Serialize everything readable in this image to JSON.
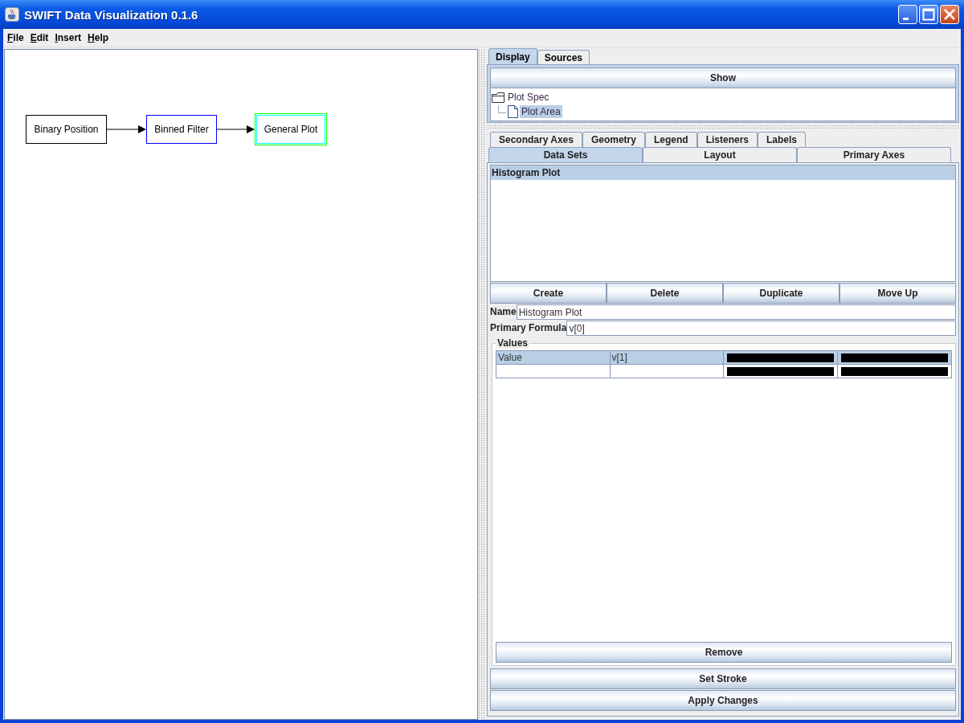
{
  "window": {
    "title": "SWIFT Data Visualization 0.1.6"
  },
  "menu": [
    {
      "label": "File"
    },
    {
      "label": "Edit"
    },
    {
      "label": "Insert"
    },
    {
      "label": "Help"
    }
  ],
  "canvas": {
    "nodes": [
      {
        "label": "Binary Position",
        "color": "#000000",
        "selected": false
      },
      {
        "label": "Binned Filter",
        "color": "#0000ff",
        "selected": false
      },
      {
        "label": "General Plot",
        "color": "#00ff00",
        "selected": true
      }
    ]
  },
  "tabs": [
    {
      "label": "Display",
      "selected": true
    },
    {
      "label": "Sources",
      "selected": false
    }
  ],
  "show_button": "Show",
  "tree": [
    {
      "label": "Plot Spec",
      "kind": "folder",
      "selected": false,
      "children": [
        {
          "label": "Plot Area",
          "kind": "file",
          "selected": true
        }
      ]
    }
  ],
  "inner_tabs": {
    "back_row": [
      {
        "label": "Secondary Axes",
        "selected": false
      },
      {
        "label": "Geometry",
        "selected": false
      },
      {
        "label": "Legend",
        "selected": false
      },
      {
        "label": "Listeners",
        "selected": false
      },
      {
        "label": "Labels",
        "selected": false
      }
    ],
    "front_row": [
      {
        "label": "Data Sets",
        "selected": true
      },
      {
        "label": "Layout",
        "selected": false
      },
      {
        "label": "Primary Axes",
        "selected": false
      }
    ]
  },
  "data_sets": [
    {
      "label": "Histogram Plot",
      "selected": true
    }
  ],
  "actions": [
    "Create",
    "Delete",
    "Duplicate",
    "Move Up"
  ],
  "fields": [
    {
      "label": "Name",
      "value": "Histogram Plot"
    },
    {
      "label": "Primary Formula",
      "value": "v[0]"
    }
  ],
  "values": {
    "title": "Values",
    "rows": [
      {
        "selected": true,
        "cells": [
          {
            "kind": "text",
            "text": "Value"
          },
          {
            "kind": "text",
            "text": "v[1]"
          },
          {
            "kind": "swatch",
            "color": "#000000"
          },
          {
            "kind": "swatch",
            "color": "#000000"
          }
        ]
      },
      {
        "selected": false,
        "cells": [
          {
            "kind": "empty"
          },
          {
            "kind": "empty"
          },
          {
            "kind": "swatch",
            "color": "#000000"
          },
          {
            "kind": "swatch",
            "color": "#000000"
          }
        ]
      }
    ],
    "remove_button": "Remove"
  },
  "bottom_buttons": [
    "Set Stroke",
    "Apply Changes"
  ]
}
